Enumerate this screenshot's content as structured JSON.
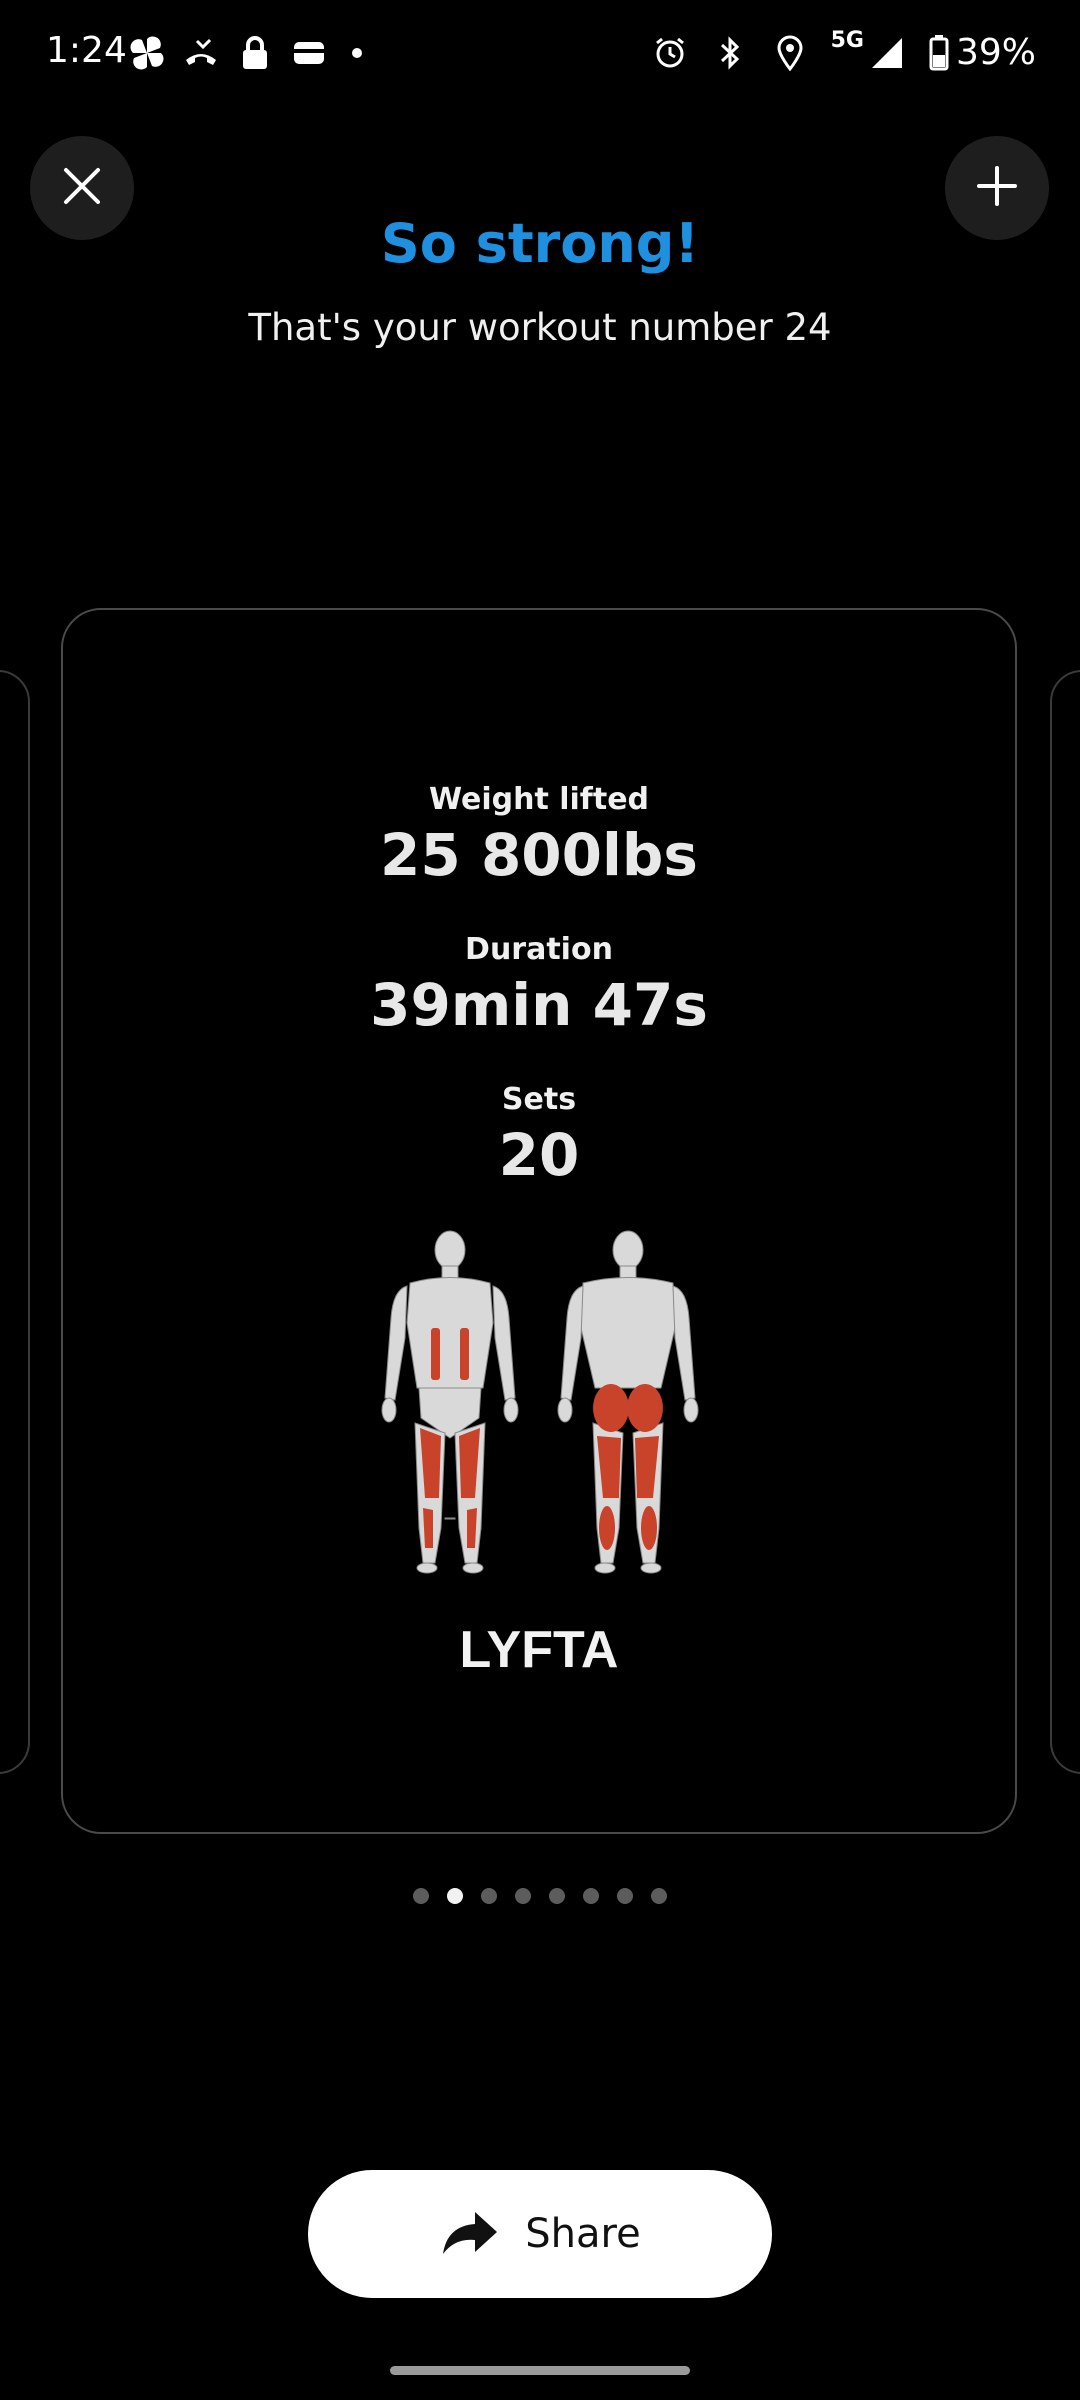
{
  "status_bar": {
    "time": "1:24",
    "network": "5G",
    "battery": "39%",
    "icons_left": [
      "pinwheel-icon",
      "missed-call-icon",
      "lock-icon",
      "wallet-icon",
      "dot-icon"
    ],
    "icons_right": [
      "alarm-icon",
      "bluetooth-icon",
      "location-icon",
      "signal-icon",
      "battery-icon"
    ]
  },
  "header": {
    "title": "So strong!",
    "subtitle": "That's your workout number 24"
  },
  "card": {
    "stats": [
      {
        "label": "Weight lifted",
        "value": "25 800lbs"
      },
      {
        "label": "Duration",
        "value": "39min 47s"
      },
      {
        "label": "Sets",
        "value": "20"
      }
    ],
    "brand": "LYFTA"
  },
  "pagination": {
    "total": 8,
    "active_index": 1
  },
  "share_button": {
    "label": "Share"
  },
  "colors": {
    "accent": "#1f8fe0",
    "muscle_highlight": "#c8432a"
  }
}
